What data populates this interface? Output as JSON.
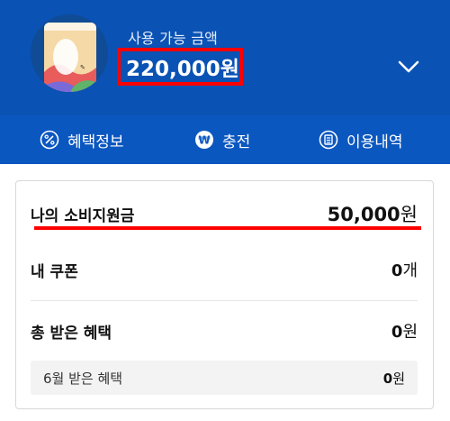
{
  "header": {
    "balance_label": "사용 가능 금액",
    "balance_amount": "220,000원",
    "background_color": "#0a52b4"
  },
  "tabs": [
    {
      "label": "혜택정보",
      "icon": "percent-icon"
    },
    {
      "label": "충전",
      "icon": "won-icon"
    },
    {
      "label": "이용내역",
      "icon": "receipt-icon"
    }
  ],
  "summary": {
    "subsidy": {
      "label": "나의 소비지원금",
      "amount": "50,000",
      "unit": "원"
    },
    "coupon": {
      "label": "내 쿠폰",
      "amount": "0",
      "unit": "개"
    },
    "total_benefit": {
      "label": "총 받은 혜택",
      "amount": "0",
      "unit": "원"
    },
    "month_benefit": {
      "label": "6월 받은 혜택",
      "amount": "0",
      "unit": "원"
    }
  },
  "highlight_color": "#ff0000"
}
